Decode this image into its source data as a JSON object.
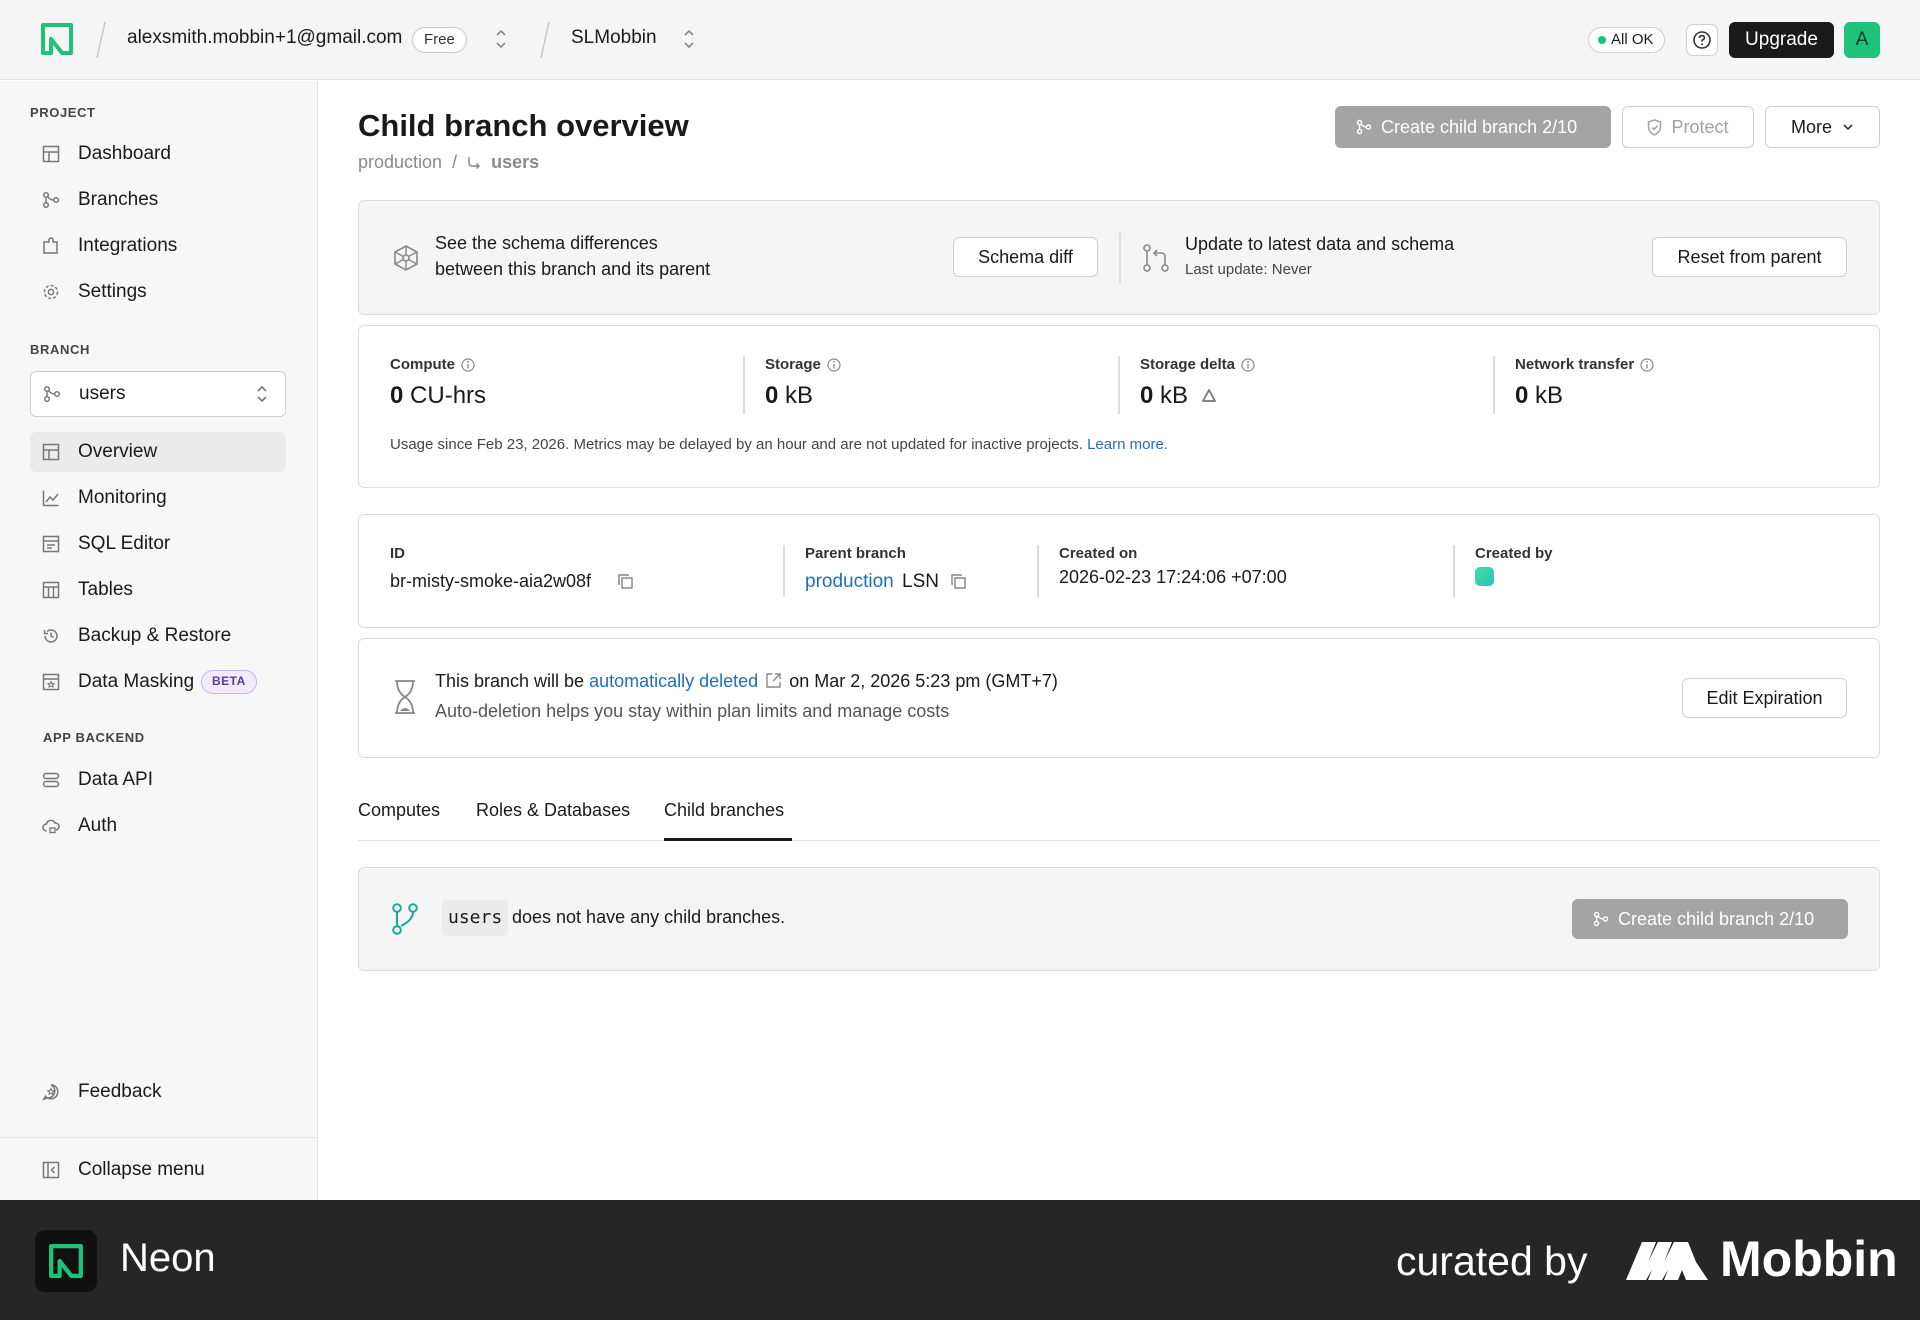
{
  "topbar": {
    "account_email": "alexsmith.mobbin+1@gmail.com",
    "plan_badge": "Free",
    "project_name": "SLMobbin",
    "status_text": "All OK",
    "upgrade_label": "Upgrade",
    "avatar_initial": "A"
  },
  "sidebar": {
    "project_section": "PROJECT",
    "project_items": [
      {
        "label": "Dashboard",
        "icon": "grid-icon"
      },
      {
        "label": "Branches",
        "icon": "branch-icon"
      },
      {
        "label": "Integrations",
        "icon": "puzzle-icon"
      },
      {
        "label": "Settings",
        "icon": "gear-icon"
      }
    ],
    "branch_section": "BRANCH",
    "branch_selected": "users",
    "branch_items": [
      {
        "label": "Overview",
        "icon": "grid-icon",
        "active": true
      },
      {
        "label": "Monitoring",
        "icon": "chart-icon"
      },
      {
        "label": "SQL Editor",
        "icon": "editor-icon"
      },
      {
        "label": "Tables",
        "icon": "table-icon"
      },
      {
        "label": "Backup & Restore",
        "icon": "history-icon"
      },
      {
        "label": "Data Masking",
        "icon": "mask-icon",
        "badge": "BETA"
      }
    ],
    "backend_section": "APP BACKEND",
    "backend_items": [
      {
        "label": "Data API",
        "icon": "api-icon"
      },
      {
        "label": "Auth",
        "icon": "cloud-lock-icon"
      }
    ],
    "feedback_label": "Feedback",
    "collapse_label": "Collapse menu"
  },
  "header": {
    "title": "Child branch overview",
    "breadcrumb_parent": "production",
    "breadcrumb_separator": "/",
    "breadcrumb_current": "users",
    "create_child_label": "Create child branch 2/10",
    "protect_label": "Protect",
    "more_label": "More"
  },
  "schema_card": {
    "line1": "See the schema differences",
    "line2": "between this branch and its parent",
    "schema_diff_label": "Schema diff",
    "update_title": "Update to latest data and schema",
    "last_update": "Last update: Never",
    "reset_label": "Reset from parent"
  },
  "metrics": {
    "items": [
      {
        "label": "Compute",
        "value": "0",
        "unit": "CU-hrs"
      },
      {
        "label": "Storage",
        "value": "0",
        "unit": "kB"
      },
      {
        "label": "Storage delta",
        "value": "0",
        "unit": "kB"
      },
      {
        "label": "Network transfer",
        "value": "0",
        "unit": "kB"
      }
    ],
    "note": "Usage since Feb 23, 2026. Metrics may be delayed by an hour and are not updated for inactive projects.",
    "learn_more": "Learn more."
  },
  "details": {
    "id_label": "ID",
    "id_value": "br-misty-smoke-aia2w08f",
    "parent_label": "Parent branch",
    "parent_value": "production",
    "parent_suffix": "LSN",
    "created_on_label": "Created on",
    "created_on_value": "2026-02-23 17:24:06 +07:00",
    "created_by_label": "Created by",
    "creator_color": "#3fe0a0"
  },
  "expiration": {
    "prefix": "This branch will be",
    "link": "automatically deleted",
    "suffix": "on Mar 2, 2026 5:23 pm (GMT+7)",
    "subtext": "Auto-deletion helps you stay within plan limits and manage costs",
    "edit_label": "Edit Expiration"
  },
  "tabs": [
    {
      "label": "Computes"
    },
    {
      "label": "Roles & Databases"
    },
    {
      "label": "Child branches",
      "active": true
    }
  ],
  "child_branches": {
    "branch_code": "users",
    "empty_text": "does not have any child branches.",
    "create_label": "Create child branch 2/10"
  },
  "footer": {
    "brand": "Neon",
    "curated_by": "curated by",
    "mobbin": "Mobbin"
  },
  "colors": {
    "accent_green": "#1ec27a",
    "link_blue": "#1e6fb8",
    "disabled_gray": "#a4a4a4"
  }
}
